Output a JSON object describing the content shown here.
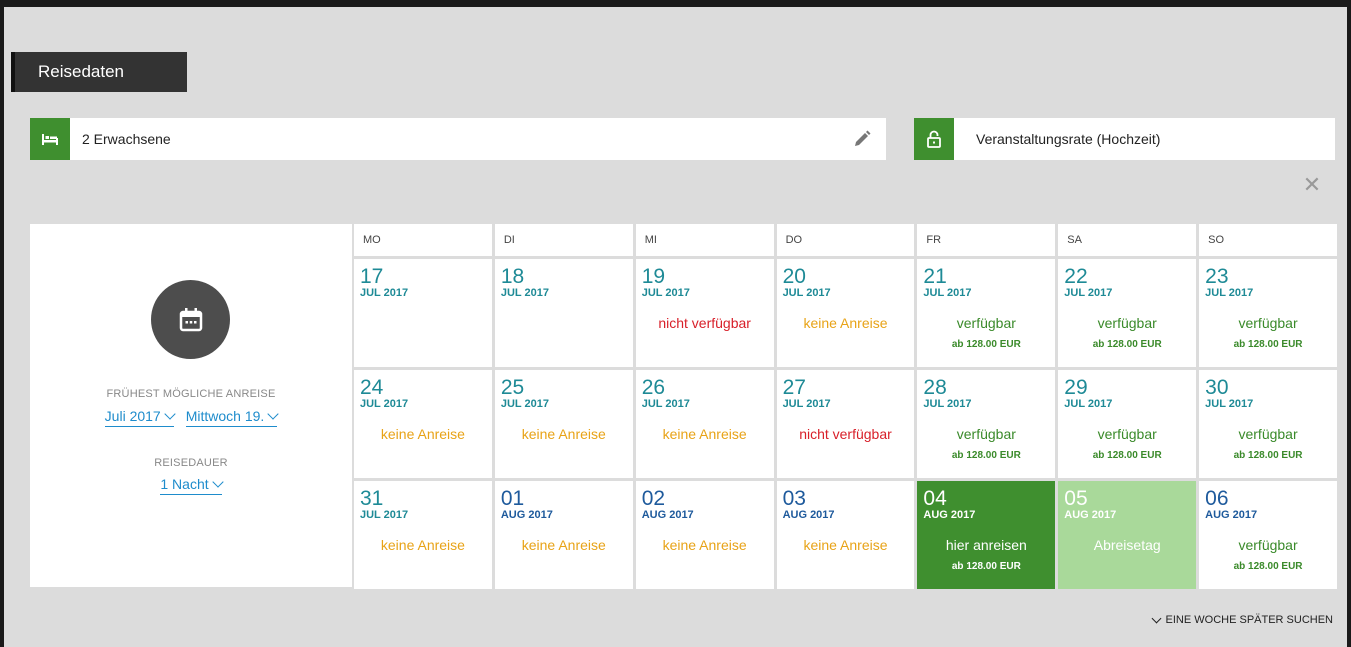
{
  "header": {
    "title": "Reisedaten"
  },
  "guests": {
    "label": "2 Erwachsene",
    "icon": "bed-icon"
  },
  "rate": {
    "label": "Veranstaltungsrate (Hochzeit)",
    "icon": "lock-icon"
  },
  "colors": {
    "green": "#3f8f2f",
    "light_green": "#a9d99a",
    "link_blue": "#1e8ccc",
    "orange": "#e8a317",
    "red": "#d8202a"
  },
  "left": {
    "earliest_label": "FRÜHEST MÖGLICHE ANREISE",
    "month_select": "Juli 2017",
    "day_select": "Mittwoch 19.",
    "duration_label": "REISEDAUER",
    "duration_select": "1 Nacht"
  },
  "weekdays": [
    "MO",
    "DI",
    "MI",
    "DO",
    "FR",
    "SA",
    "SO"
  ],
  "weeks": [
    [
      {
        "day": "17",
        "month": "JUL 2017",
        "status": "",
        "price": ""
      },
      {
        "day": "18",
        "month": "JUL 2017",
        "status": "",
        "price": ""
      },
      {
        "day": "19",
        "month": "JUL 2017",
        "status": "nicht verfügbar",
        "price": ""
      },
      {
        "day": "20",
        "month": "JUL 2017",
        "status": "keine Anreise",
        "price": ""
      },
      {
        "day": "21",
        "month": "JUL 2017",
        "status": "verfügbar",
        "price": "ab 128.00 EUR"
      },
      {
        "day": "22",
        "month": "JUL 2017",
        "status": "verfügbar",
        "price": "ab 128.00 EUR"
      },
      {
        "day": "23",
        "month": "JUL 2017",
        "status": "verfügbar",
        "price": "ab 128.00 EUR"
      }
    ],
    [
      {
        "day": "24",
        "month": "JUL 2017",
        "status": "keine Anreise",
        "price": ""
      },
      {
        "day": "25",
        "month": "JUL 2017",
        "status": "keine Anreise",
        "price": ""
      },
      {
        "day": "26",
        "month": "JUL 2017",
        "status": "keine Anreise",
        "price": ""
      },
      {
        "day": "27",
        "month": "JUL 2017",
        "status": "nicht verfügbar",
        "price": ""
      },
      {
        "day": "28",
        "month": "JUL 2017",
        "status": "verfügbar",
        "price": "ab 128.00 EUR"
      },
      {
        "day": "29",
        "month": "JUL 2017",
        "status": "verfügbar",
        "price": "ab 128.00 EUR"
      },
      {
        "day": "30",
        "month": "JUL 2017",
        "status": "verfügbar",
        "price": "ab 128.00 EUR"
      }
    ],
    [
      {
        "day": "31",
        "month": "JUL 2017",
        "status": "keine Anreise",
        "price": ""
      },
      {
        "day": "01",
        "month": "AUG 2017",
        "status": "keine Anreise",
        "price": ""
      },
      {
        "day": "02",
        "month": "AUG 2017",
        "status": "keine Anreise",
        "price": ""
      },
      {
        "day": "03",
        "month": "AUG 2017",
        "status": "keine Anreise",
        "price": ""
      },
      {
        "day": "04",
        "month": "AUG 2017",
        "status": "hier anreisen",
        "price": "ab 128.00 EUR"
      },
      {
        "day": "05",
        "month": "AUG 2017",
        "status": "Abreisetag",
        "price": ""
      },
      {
        "day": "06",
        "month": "AUG 2017",
        "status": "verfügbar",
        "price": "ab 128.00 EUR"
      }
    ]
  ],
  "footer": {
    "later_label": "EINE WOCHE SPÄTER SUCHEN"
  }
}
